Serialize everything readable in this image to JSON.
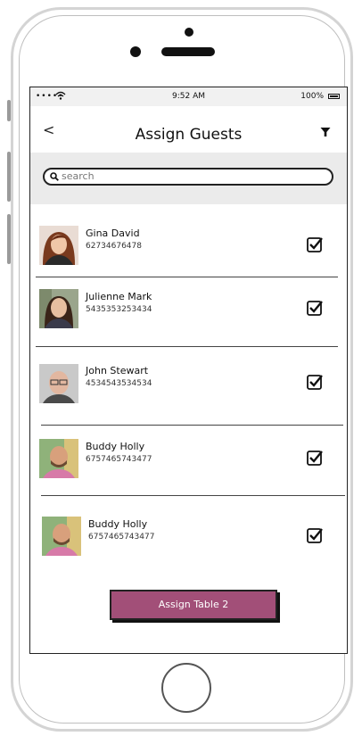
{
  "status_bar": {
    "signal": "•••••",
    "time": "9:52 AM",
    "battery": "100%"
  },
  "header": {
    "back": "<",
    "title": "Assign Guests"
  },
  "search": {
    "placeholder": "search"
  },
  "guests": [
    {
      "name": "Gina David",
      "phone": "62734676478",
      "checked": true
    },
    {
      "name": "Julienne Mark",
      "phone": "5435353253434",
      "checked": true
    },
    {
      "name": "John Stewart",
      "phone": "4534543534534",
      "checked": true
    },
    {
      "name": "Buddy Holly",
      "phone": "6757465743477",
      "checked": true
    },
    {
      "name": "Buddy Holly",
      "phone": "6757465743477",
      "checked": true
    }
  ],
  "assign_button": {
    "label": "Assign Table 2"
  },
  "colors": {
    "accent": "#a24f78",
    "search_bg": "#ebebeb",
    "status_bg": "#f1f1f1"
  }
}
